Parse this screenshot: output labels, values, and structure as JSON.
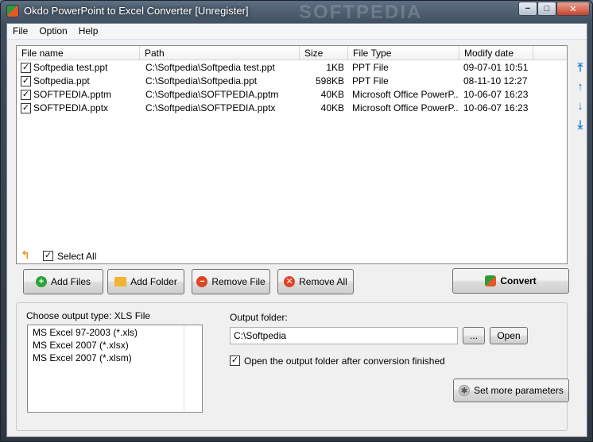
{
  "window": {
    "title": "Okdo PowerPoint to Excel Converter [Unregister]",
    "watermark": "SOFTPEDIA",
    "controls": {
      "minimize": "−",
      "maximize": "□",
      "close": "✕"
    }
  },
  "menu": [
    "File",
    "Option",
    "Help"
  ],
  "file_list": {
    "columns": [
      "File name",
      "Path",
      "Size",
      "File Type",
      "Modify date"
    ],
    "rows": [
      {
        "checked": true,
        "name": "Softpedia test.ppt",
        "path": "C:\\Softpedia\\Softpedia test.ppt",
        "size": "1KB",
        "type": "PPT File",
        "date": "09-07-01 10:51"
      },
      {
        "checked": true,
        "name": "Softpedia.ppt",
        "path": "C:\\Softpedia\\Softpedia.ppt",
        "size": "598KB",
        "type": "PPT File",
        "date": "08-11-10 12:27"
      },
      {
        "checked": true,
        "name": "SOFTPEDIA.pptm",
        "path": "C:\\Softpedia\\SOFTPEDIA.pptm",
        "size": "40KB",
        "type": "Microsoft Office PowerP...",
        "date": "10-06-07 16:23"
      },
      {
        "checked": true,
        "name": "SOFTPEDIA.pptx",
        "path": "C:\\Softpedia\\SOFTPEDIA.pptx",
        "size": "40KB",
        "type": "Microsoft Office PowerP...",
        "date": "10-06-07 16:23"
      }
    ]
  },
  "side_arrows": [
    "move-top-icon",
    "move-up-icon",
    "move-down-icon",
    "move-bottom-icon"
  ],
  "select_all": {
    "label": "Select All",
    "checked": true
  },
  "buttons": {
    "add_files": "Add Files",
    "add_folder": "Add Folder",
    "remove_file": "Remove File",
    "remove_all": "Remove All",
    "convert": "Convert"
  },
  "output": {
    "type_label": "Choose output type:  XLS File",
    "types": [
      "MS Excel 97-2003 (*.xls)",
      "MS Excel 2007 (*.xlsx)",
      "MS Excel 2007 (*.xlsm)"
    ],
    "folder_label": "Output folder:",
    "folder_value": "C:\\Softpedia",
    "browse_label": "...",
    "open_label": "Open",
    "open_after_label": "Open the output folder after conversion finished",
    "open_after_checked": true,
    "params_label": "Set more parameters"
  },
  "colors": {
    "accent": "#1e7fd4",
    "convert_green": "#2e9b3b",
    "convert_orange": "#e25a24"
  }
}
